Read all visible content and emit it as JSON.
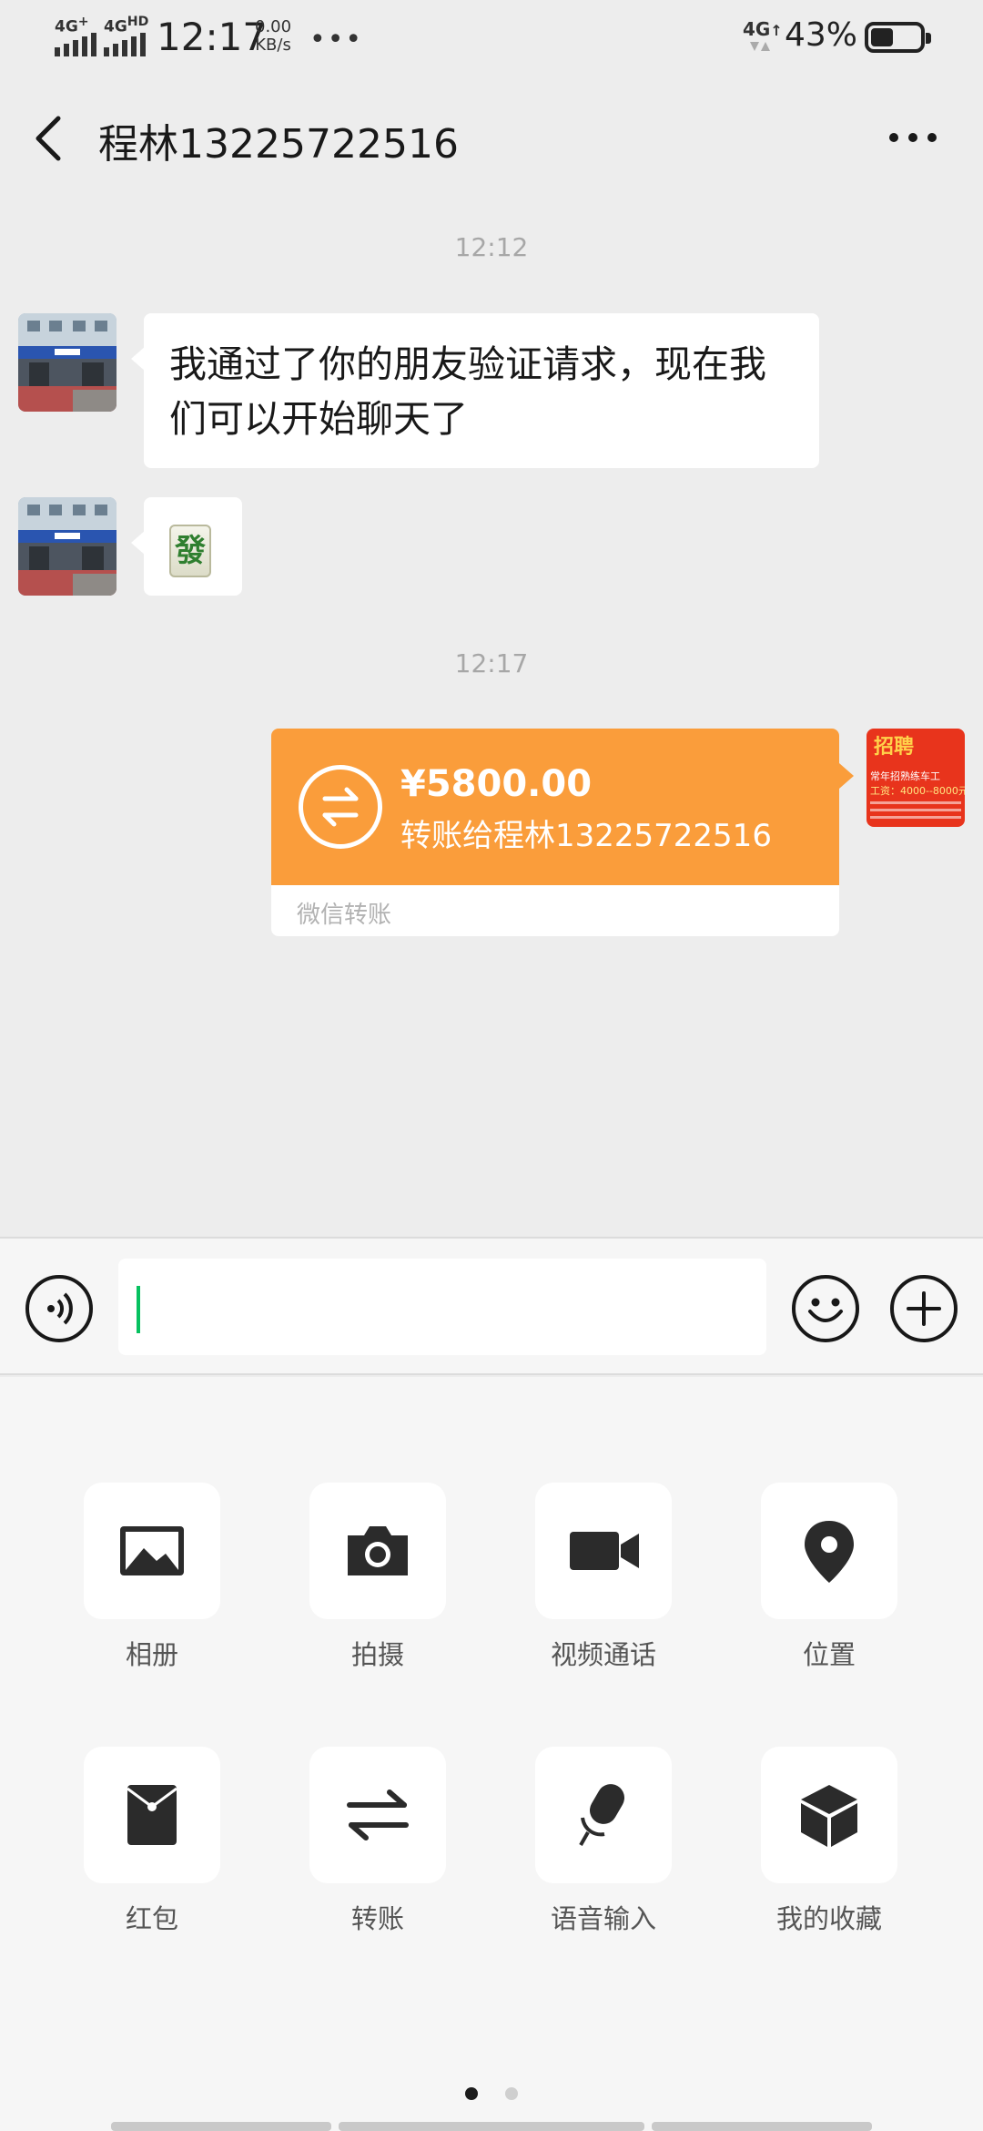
{
  "status_bar": {
    "signal_1": "4G⁺",
    "signal_2": "4GᴴᴰHD",
    "time": "12:17",
    "speed_value": "0.00",
    "speed_unit": "KB/s",
    "more": "•••",
    "network": "4G",
    "battery_percent": "43%",
    "battery_level": 0.43
  },
  "header": {
    "title": "程林13225722516",
    "back_icon": "chevron-left-icon",
    "more_icon": "more-horizontal-icon"
  },
  "chat": {
    "timestamp_1": "12:12",
    "message_1": "我通过了你的朋友验证请求，现在我们可以开始聊天了",
    "message_2_emoji": "發",
    "timestamp_2": "12:17",
    "transfer": {
      "amount": "¥5800.00",
      "description": "转账给程林13225722516",
      "footer": "微信转账",
      "color": "#fa9d3b"
    },
    "self_avatar": {
      "heading": "招聘",
      "line_1": "常年招熟练车工",
      "line_2": "工资：4000--8000元"
    }
  },
  "input_bar": {
    "voice_icon": "voice-icon",
    "emoji_icon": "emoji-icon",
    "plus_icon": "plus-circle-icon"
  },
  "panel": {
    "items": [
      {
        "label": "相册",
        "icon": "photo-album-icon"
      },
      {
        "label": "拍摄",
        "icon": "camera-icon"
      },
      {
        "label": "视频通话",
        "icon": "video-call-icon"
      },
      {
        "label": "位置",
        "icon": "location-pin-icon"
      },
      {
        "label": "红包",
        "icon": "red-packet-icon"
      },
      {
        "label": "转账",
        "icon": "transfer-icon"
      },
      {
        "label": "语音输入",
        "icon": "microphone-icon"
      },
      {
        "label": "我的收藏",
        "icon": "favorites-box-icon"
      }
    ],
    "page_index": 1,
    "page_count": 2
  },
  "colors": {
    "accent_green": "#07c160",
    "background": "#ededed"
  }
}
